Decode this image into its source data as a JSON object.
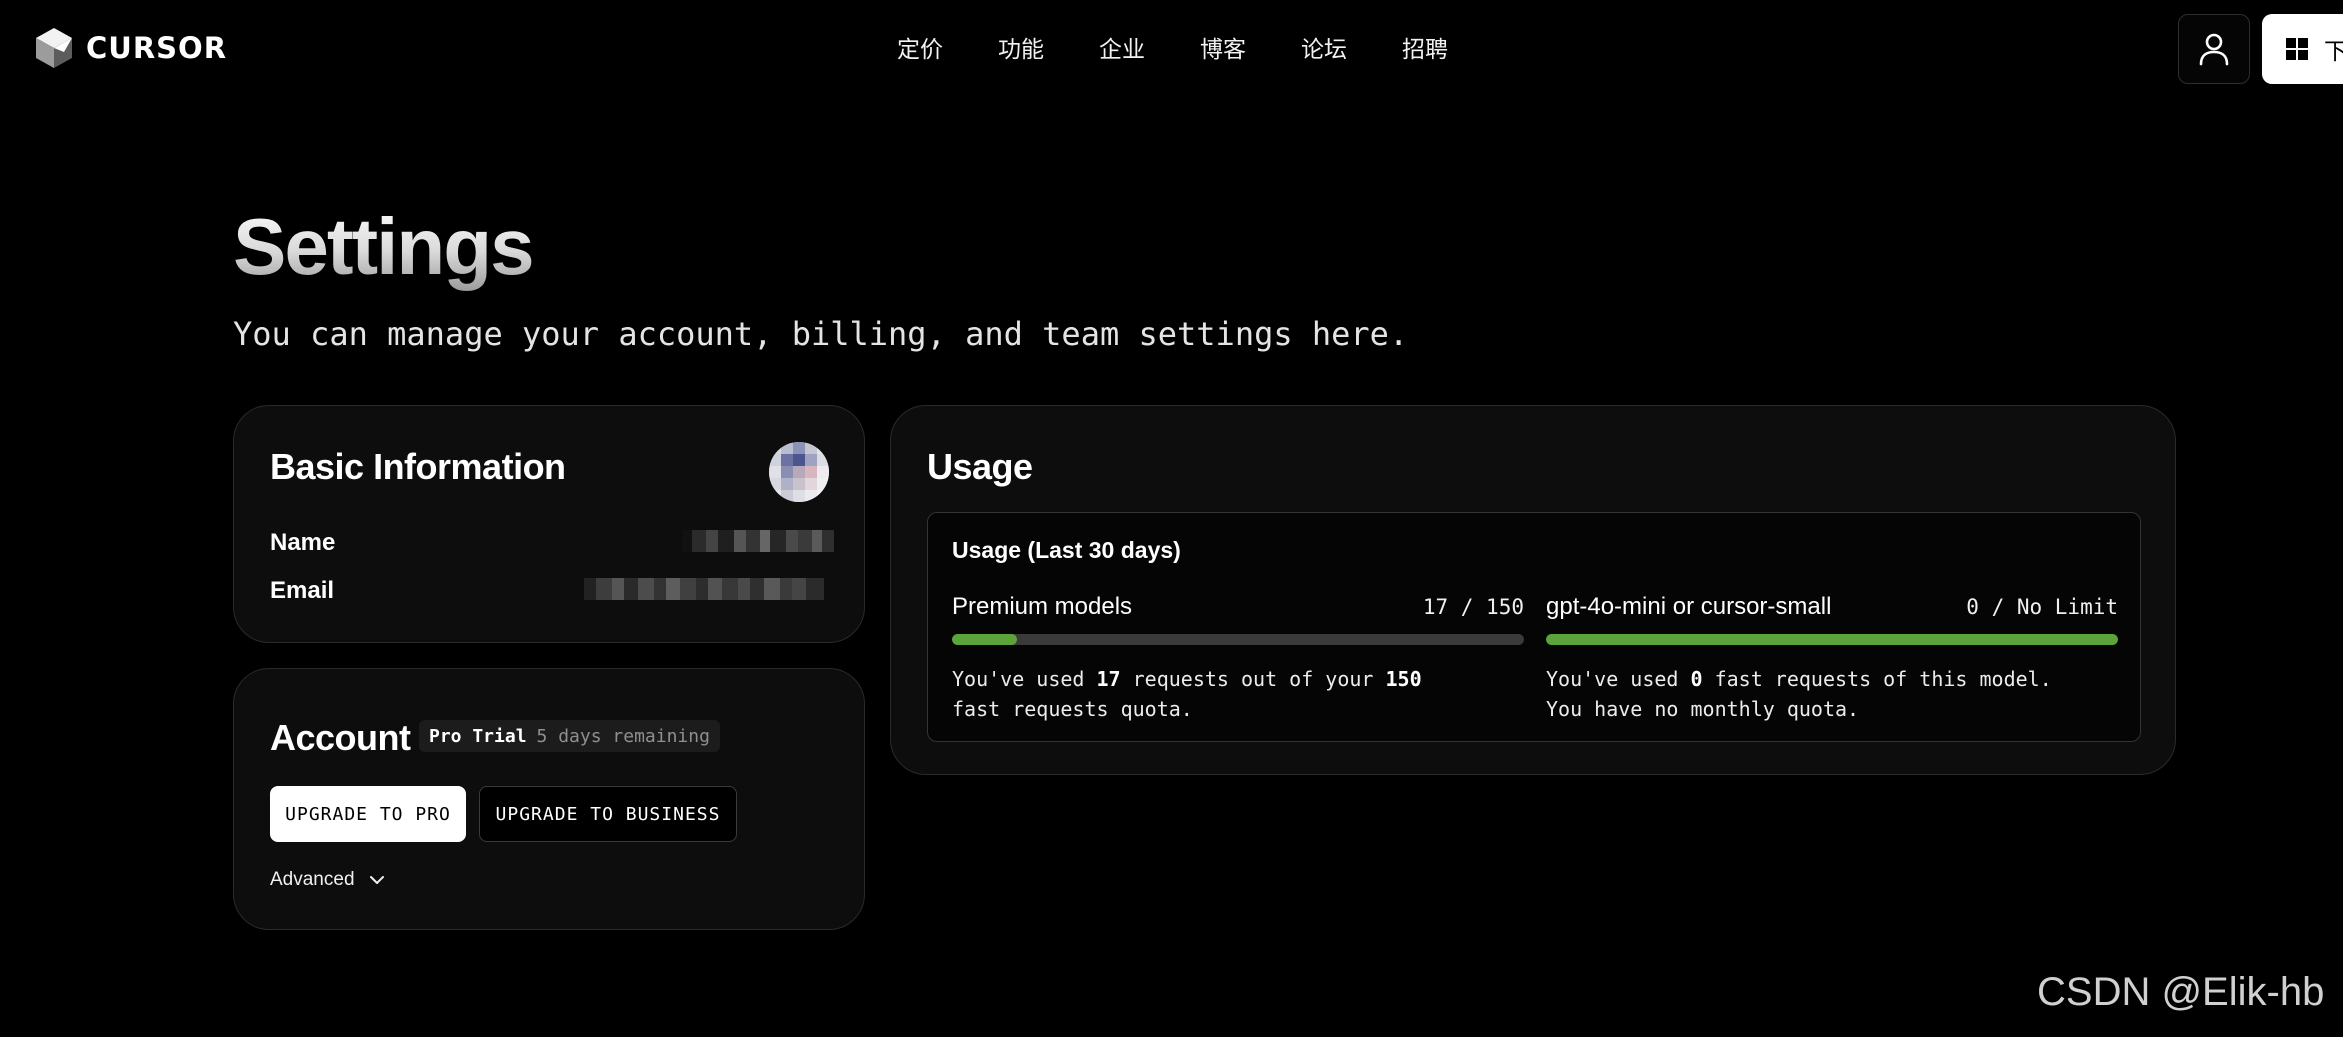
{
  "brand": {
    "logo_text": "CURSOR"
  },
  "nav": {
    "items": [
      {
        "label": "定价"
      },
      {
        "label": "功能"
      },
      {
        "label": "企业"
      },
      {
        "label": "博客"
      },
      {
        "label": "论坛"
      },
      {
        "label": "招聘"
      }
    ],
    "download_label": "下"
  },
  "header": {
    "title": "Settings",
    "subtitle": "You can manage your account, billing, and team settings here."
  },
  "basic_info": {
    "title": "Basic Information",
    "name_label": "Name",
    "email_label": "Email"
  },
  "account": {
    "title": "Account",
    "plan": "Pro Trial",
    "remaining": "5 days remaining",
    "upgrade_pro_label": "UPGRADE TO PRO",
    "upgrade_business_label": "UPGRADE TO BUSINESS",
    "advanced_label": "Advanced"
  },
  "usage": {
    "title": "Usage",
    "panel_title": "Usage (Last 30 days)",
    "meters": [
      {
        "name": "Premium models",
        "count": "17 / 150",
        "used_fraction": 0.113,
        "desc_prefix": "You've used ",
        "desc_used": "17",
        "desc_middle": " requests out of your ",
        "desc_total": "150",
        "desc_suffix": "\nfast requests quota."
      },
      {
        "name": "gpt-4o-mini or cursor-small",
        "count": "0 / No Limit",
        "used_fraction": 1.0,
        "desc_prefix": "You've used ",
        "desc_used": "0",
        "desc_suffix": " fast requests of this model.\nYou have no monthly quota."
      }
    ]
  },
  "watermark": "CSDN @Elik-hb",
  "colors": {
    "background": "#000000",
    "card": "#0d0d0d",
    "progress_fill": "#5aa43a",
    "progress_track": "#3a3a3a"
  }
}
